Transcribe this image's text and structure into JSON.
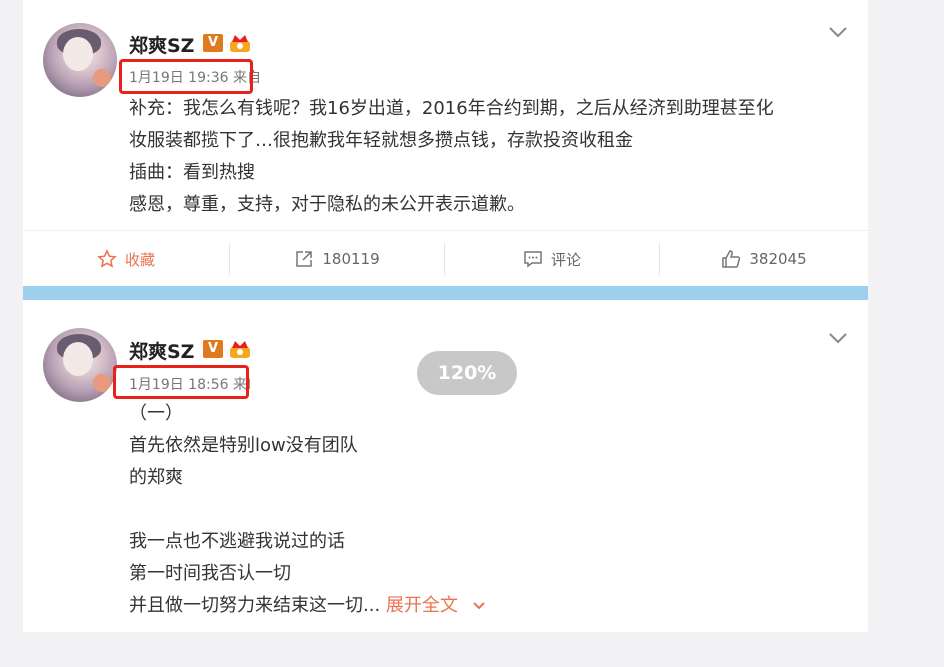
{
  "posts": [
    {
      "username": "郑爽SZ",
      "badge_v": "V",
      "timestamp": "1月19日 19:36",
      "source_prefix": "来自",
      "lines": [
        "补充：我怎么有钱呢？我16岁出道，2016年合约到期，之后从经济到助理甚至化",
        "妆服装都揽下了…很抱歉我年轻就想多攒点钱，存款投资收租金",
        "插曲：看到热搜",
        "感恩，尊重，支持，对于隐私的未公开表示道歉。"
      ],
      "actions": {
        "favorite_label": "收藏",
        "repost_count": "180119",
        "comment_label": "评论",
        "like_count": "382045"
      }
    },
    {
      "username": "郑爽SZ",
      "badge_v": "V",
      "timestamp": "1月19日 18:56",
      "source_prefix": "来I",
      "lines": [
        "（一）",
        "首先依然是特别low没有团队",
        "的郑爽",
        "",
        "我一点也不逃避我说过的话",
        "第一时间我否认一切"
      ],
      "last_line": "并且做一切努力来结束这一切...",
      "expand_label": "展开全文"
    }
  ],
  "zoom_indicator": "120%",
  "colors": {
    "highlight_box": "#e8211b",
    "accent_orange": "#eb7350",
    "divider_blue": "#9ed0ee",
    "verified_badge": "#e07a1f"
  }
}
